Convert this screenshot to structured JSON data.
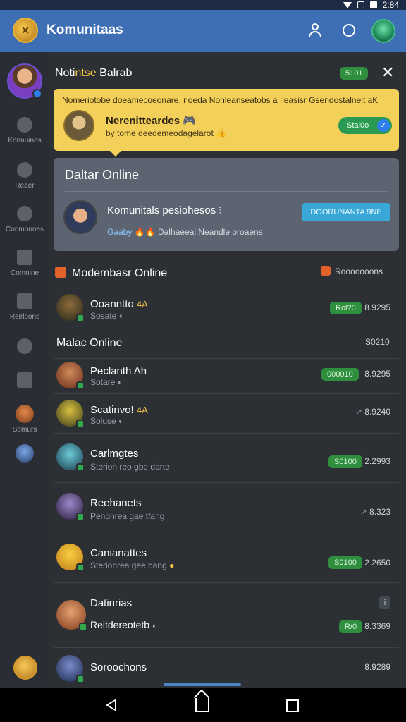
{
  "status_bar": {
    "time": "2:84"
  },
  "app": {
    "title": "Komunitaas",
    "logo_icon": "guild-emblem-icon"
  },
  "rail": {
    "items": [
      {
        "label": "Konnuines",
        "icon": "puzzle-icon"
      },
      {
        "label": "Reaer",
        "icon": "controller-icon"
      },
      {
        "label": "Conmonnes",
        "icon": "shield-icon"
      },
      {
        "label": "Comnine",
        "icon": "grid-icon"
      },
      {
        "label": "Reirloons",
        "icon": "chat-icon"
      },
      {
        "label": "",
        "icon": "bubble-icon"
      },
      {
        "label": "",
        "icon": "pin-icon"
      },
      {
        "label": "Somurs",
        "icon": "avatar"
      }
    ]
  },
  "notification": {
    "title_prefix": "Noti",
    "title_highlight": "ntse",
    "title_suffix": " Balrab",
    "pill": "5101",
    "banner_line": "Nomeriotobe doeamecoeonare, noeda Nonleanseatobs a Ileasisr Gsendostalnelt aK",
    "banner_name": "Nerenitteardes",
    "banner_sub": "by  tome deedemeodagelarot",
    "banner_button": "Stal0o"
  },
  "daltar": {
    "title": "Daltar Online",
    "name": "Komunitals pesiohesos",
    "sub_highlight": "Gaaby",
    "sub": "Dalhaeeal,Neandle oroaens",
    "button": "DOORUNANTA 9NE"
  },
  "section_moderator": {
    "title": "Modembasr Online",
    "right": "Rooooooons"
  },
  "section_main": {
    "title": "Malac Online",
    "right": "S0210"
  },
  "rows": [
    {
      "name": "Ooanntto",
      "emoji": "4A",
      "sub": "Sosate",
      "pill": "Rol?0",
      "value": "8.9295",
      "color": "#3b4a2a"
    },
    {
      "name": "Peclanth Ah",
      "emoji": "",
      "sub": "Sotare",
      "pill": "000010",
      "value": "8.9295",
      "color": "#8a4a2a"
    },
    {
      "name": "Scatinvo!",
      "emoji": "4A",
      "sub": "Soluse",
      "pill": "",
      "value": "8.9240",
      "color": "#8a7a1a"
    },
    {
      "name": "Carlmgtes",
      "emoji": "",
      "sub": "Sterion reo gbe darte",
      "pill": "S0100",
      "value": "2.2993",
      "color": "#3a8a9a"
    },
    {
      "name": "Reehanets",
      "emoji": "",
      "sub": "Penonrea gae tfang",
      "pill": "",
      "value": "8.323",
      "color": "#4a3a5a"
    },
    {
      "name": "Canianattes",
      "emoji": "",
      "sub": "Sterionrea gee bang",
      "pill": "S0100",
      "value": "2.2650",
      "color": "#e0a020"
    },
    {
      "name": "Datinrias",
      "emoji": "",
      "sub": "",
      "pill": "",
      "value": "",
      "color": "#c06a3a"
    },
    {
      "name": "Reitdereotetb",
      "emoji": "",
      "sub": "",
      "pill": "R/0",
      "value": "8.3369",
      "color": "#c06a3a"
    },
    {
      "name": "Soroochons",
      "emoji": "",
      "sub": "",
      "pill": "",
      "value": "8.9289",
      "color": "#3a4a7a"
    }
  ]
}
